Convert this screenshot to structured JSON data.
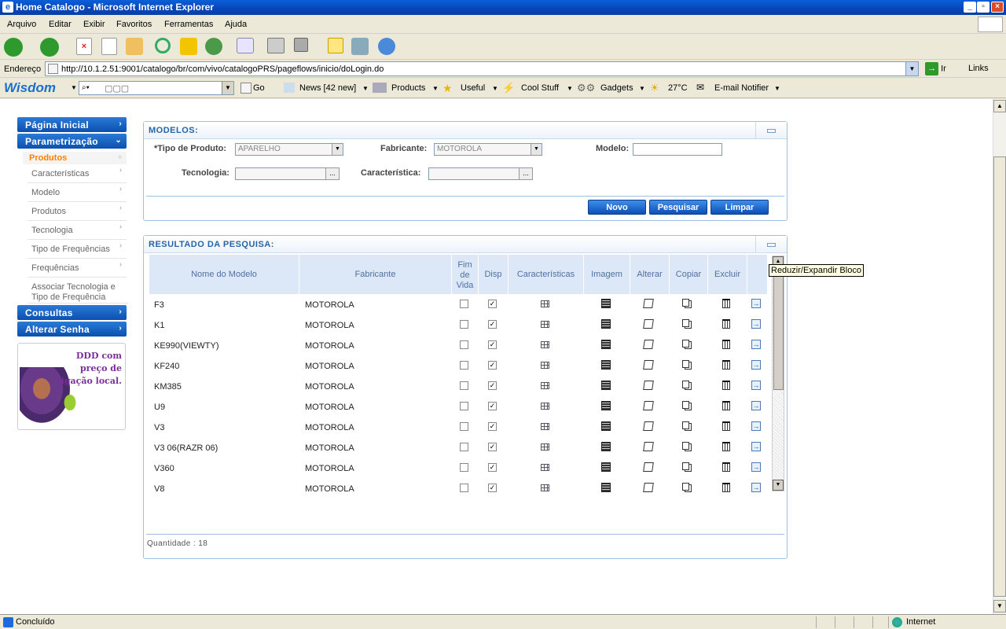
{
  "window": {
    "title": "Home Catalogo - Microsoft Internet Explorer"
  },
  "menu": [
    "Arquivo",
    "Editar",
    "Exibir",
    "Favoritos",
    "Ferramentas",
    "Ajuda"
  ],
  "address": {
    "label": "Endereço",
    "url": "http://10.1.2.51:9001/catalogo/br/com/vivo/catalogoPRS/pageflows/inicio/doLogin.do",
    "go": "Ir",
    "links": "Links"
  },
  "wisdom": {
    "logo": "Wisdom",
    "search_placeholder": "▢▢▢",
    "go": "Go",
    "news": "News [42 new]",
    "products": "Products",
    "useful": "Useful",
    "cool": "Cool Stuff",
    "gadgets": "Gadgets",
    "temp": "27°C",
    "email": "E-mail Notifier"
  },
  "sidebar": {
    "pagina_inicial": "Página Inicial",
    "parametrizacao": "Parametrização",
    "produtos_header": "Produtos",
    "items": [
      "Características",
      "Modelo",
      "Produtos",
      "Tecnologia",
      "Tipo de Frequências",
      "Frequências",
      "Associar Tecnologia e Tipo de Frequência"
    ],
    "consultas": "Consultas",
    "alterar_senha": "Alterar Senha",
    "ad_text": "DDD com preço de ligação local."
  },
  "modelos": {
    "title": "MODELOS:",
    "tipo_label": "*Tipo de Produto:",
    "tipo_value": "APARELHO",
    "fabricante_label": "Fabricante:",
    "fabricante_value": "MOTOROLA",
    "modelo_label": "Modelo:",
    "modelo_value": "",
    "tecnologia_label": "Tecnologia:",
    "caracteristica_label": "Característica:",
    "lookup": "...",
    "btn_novo": "Novo",
    "btn_pesquisar": "Pesquisar",
    "btn_limpar": "Limpar"
  },
  "resultado": {
    "title": "RESULTADO DA PESQUISA:",
    "columns": [
      "Nome do Modelo",
      "Fabricante",
      "Fim de Vida",
      "Disp",
      "Características",
      "Imagem",
      "Alterar",
      "Copiar",
      "Excluir"
    ],
    "rows": [
      {
        "modelo": "F3",
        "fabricante": "MOTOROLA",
        "fim_vida": false,
        "disp": true
      },
      {
        "modelo": "K1",
        "fabricante": "MOTOROLA",
        "fim_vida": false,
        "disp": true
      },
      {
        "modelo": "KE990(VIEWTY)",
        "fabricante": "MOTOROLA",
        "fim_vida": false,
        "disp": true
      },
      {
        "modelo": "KF240",
        "fabricante": "MOTOROLA",
        "fim_vida": false,
        "disp": true
      },
      {
        "modelo": "KM385",
        "fabricante": "MOTOROLA",
        "fim_vida": false,
        "disp": true
      },
      {
        "modelo": "U9",
        "fabricante": "MOTOROLA",
        "fim_vida": false,
        "disp": true
      },
      {
        "modelo": "V3",
        "fabricante": "MOTOROLA",
        "fim_vida": false,
        "disp": true
      },
      {
        "modelo": "V3 06(RAZR 06)",
        "fabricante": "MOTOROLA",
        "fim_vida": false,
        "disp": true
      },
      {
        "modelo": "V360",
        "fabricante": "MOTOROLA",
        "fim_vida": false,
        "disp": true
      },
      {
        "modelo": "V8",
        "fabricante": "MOTOROLA",
        "fim_vida": false,
        "disp": true
      }
    ],
    "quantidade": "Quantidade : 18",
    "tooltip": "Reduzir/Expandir Bloco"
  },
  "status": {
    "text": "Concluído",
    "zone": "Internet"
  }
}
